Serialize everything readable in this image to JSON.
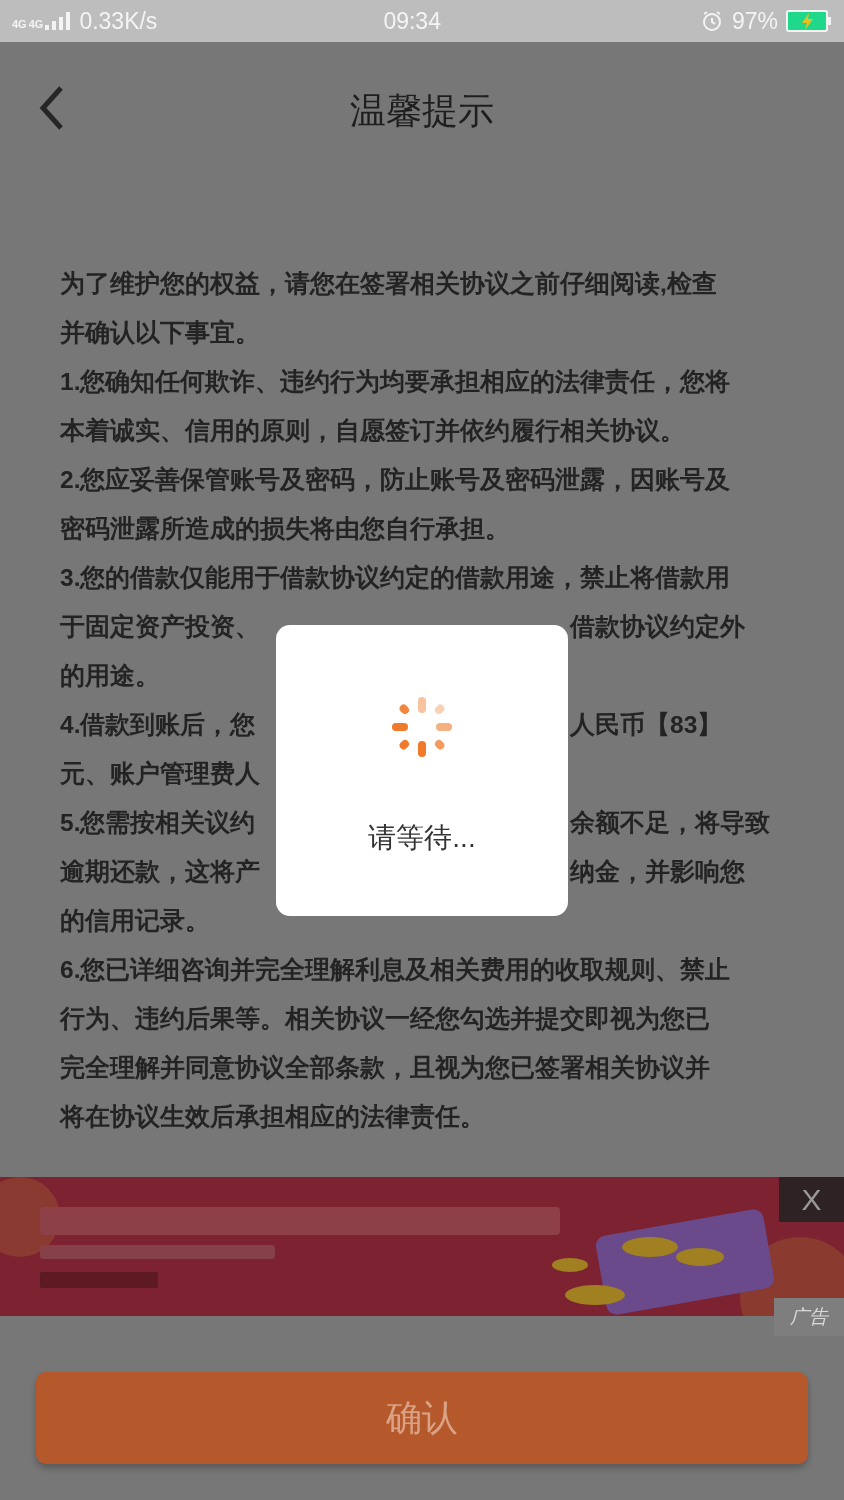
{
  "status_bar": {
    "network_labels": [
      "4G",
      "4G"
    ],
    "speed": "0.33K/s",
    "time": "09:34",
    "battery": "97%"
  },
  "header": {
    "title": "温馨提示"
  },
  "notice": {
    "lines": [
      {
        "left": "为了维护您的权益，请您在签署相关协议之前仔细阅读,检查"
      },
      {
        "left": "并确认以下事宜。"
      },
      {
        "left": "1.您确知任何欺诈、违约行为均要承担相应的法律责任，您将"
      },
      {
        "left": "本着诚实、信用的原则，自愿签订并依约履行相关协议。"
      },
      {
        "left": "2.您应妥善保管账号及密码，防止账号及密码泄露，因账号及"
      },
      {
        "left": "密码泄露所造成的损失将由您自行承担。"
      },
      {
        "left": "3.您的借款仅能用于借款协议约定的借款用途，禁止将借款用"
      },
      {
        "left": "于固定资产投资、",
        "right": "借款协议约定外"
      },
      {
        "left": "的用途。"
      },
      {
        "left": "4.借款到账后，您",
        "right": "人民币【83】"
      },
      {
        "left": "元、账户管理费人"
      },
      {
        "left": "5.您需按相关议约",
        "right": "余额不足，将导致"
      },
      {
        "left": "逾期还款，这将产",
        "right": "纳金，并影响您"
      },
      {
        "left": "的信用记录。"
      },
      {
        "left": "6.您已详细咨询并完全理解利息及相关费用的收取规则、禁止"
      },
      {
        "left": "行为、违约后果等。相关协议一经您勾选并提交即视为您已"
      },
      {
        "left": "完全理解并同意协议全部条款，且视为您已签署相关协议并"
      },
      {
        "left": "将在协议生效后承担相应的法律责任。"
      }
    ]
  },
  "ad": {
    "kind": "picture",
    "close": "X",
    "label": "广告"
  },
  "loading_dialog": {
    "message": "请等待..."
  },
  "confirm_button": {
    "label": "确认"
  }
}
